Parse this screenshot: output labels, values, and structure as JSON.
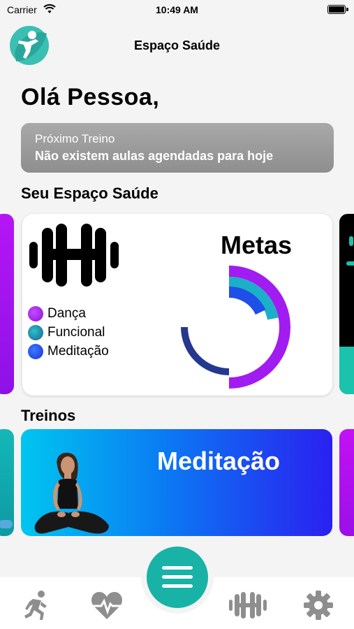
{
  "status_bar": {
    "carrier": "Carrier",
    "time": "10:49 AM"
  },
  "header": {
    "title": "Espaço Saúde",
    "logo_icon": "person-logo-icon"
  },
  "greeting": "Olá Pessoa,",
  "next_workout": {
    "label": "Próximo Treino",
    "value": "Não existem aulas agendadas para hoje"
  },
  "sections": {
    "space": "Seu Espaço Saúde",
    "workouts": "Treinos"
  },
  "goals_card": {
    "title": "Metas",
    "icon": "dumbbell-icon",
    "legend": [
      {
        "label": "Dança",
        "color": "#a11cf0"
      },
      {
        "label": "Funcional",
        "color": "#1b8a9c"
      },
      {
        "label": "Meditação",
        "color": "#1f4fe8"
      }
    ]
  },
  "chart_data": {
    "type": "radial-progress",
    "series": [
      {
        "name": "Dança",
        "value": 0.5,
        "color": "#a11cf0"
      },
      {
        "name": "Funcional",
        "value": 0.22,
        "color": "#1bb0c8"
      },
      {
        "name": "Meditação",
        "value": 0.18,
        "color": "#1f4fe8"
      }
    ],
    "inner_ring": {
      "value": 0.5,
      "color": "#25388f"
    }
  },
  "workout_card": {
    "title": "Meditação"
  },
  "tabbar": {
    "items": [
      "running-icon",
      "heartbeat-icon",
      "menu-icon",
      "dumbbell-icon",
      "gear-icon"
    ],
    "colors": {
      "active": "#18b2a6",
      "inactive": "#8e8e8e"
    }
  }
}
